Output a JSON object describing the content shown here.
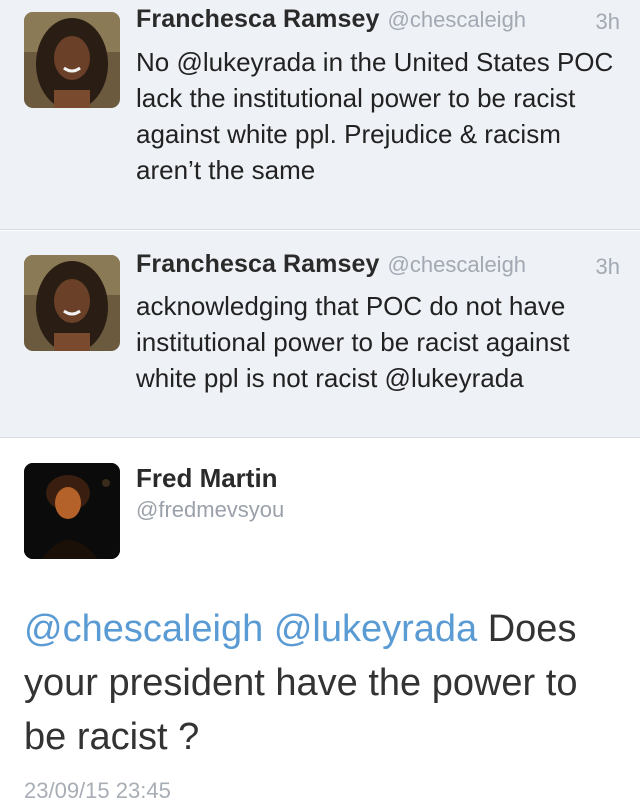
{
  "tweets": [
    {
      "name": "Franchesca Ramsey",
      "handle": "@chescaleigh",
      "time": "3h",
      "text": "No @lukeyrada in the United States POC lack the institutional power to be racist against white ppl. Prejudice & racism aren’t the same"
    },
    {
      "name": "Franchesca Ramsey",
      "handle": "@chescaleigh",
      "time": "3h",
      "text": "acknowledging that POC do not have institutional power to be racist against white ppl is not racist @lukeyrada"
    }
  ],
  "detail": {
    "name": "Fred Martin",
    "handle": "@fredmevsyou",
    "mention_1": "@chescaleigh",
    "mention_2": "@lukeyrada",
    "text_rest": "Does your president have the power to be racist ?",
    "timestamp": "23/09/15 23:45"
  },
  "colors": {
    "timeline_bg": "#eef1f6",
    "mention": "#5a9bd4",
    "muted": "#a3a9b2"
  }
}
